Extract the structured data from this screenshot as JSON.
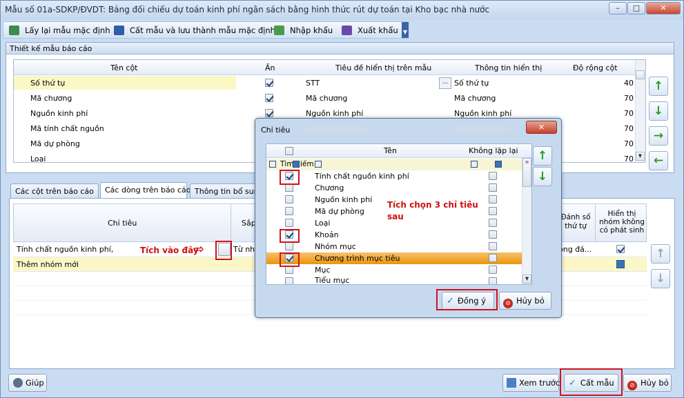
{
  "window": {
    "title": "Mẫu số 01a-SDKP/ĐVDT: Bảng đối chiếu dự toán kinh phí ngân sách bằng hình thức rút dự toán tại Kho bạc nhà nước",
    "btn_min": "–",
    "btn_max": "□",
    "btn_close": "✕"
  },
  "toolbar": {
    "reset": "Lấy lại mẫu mặc định",
    "save": "Cất mẫu và lưu thành mẫu mặc định",
    "import": "Nhập khẩu",
    "export": "Xuất khẩu"
  },
  "design": {
    "header": "Thiết kế mẫu báo cáo",
    "columns": {
      "name": "Tên cột",
      "hide": "Ẩn",
      "caption": "Tiêu đề hiển thị trên mẫu",
      "info": "Thông tin hiển thị",
      "width": "Độ rộng cột"
    },
    "rows": [
      {
        "name": "Số thứ tự",
        "hide": true,
        "caption": "STT",
        "info": "Số thứ tự",
        "width": "40"
      },
      {
        "name": "Mã chương",
        "hide": true,
        "caption": "Mã chương",
        "info": "Mã chương",
        "width": "70"
      },
      {
        "name": "Nguồn kinh phí",
        "hide": true,
        "caption": "Nguồn kinh phí",
        "info": "Nguồn kinh phí",
        "width": "70"
      },
      {
        "name": "Mã tính chất nguồn",
        "hide": false,
        "caption": "",
        "info": "",
        "width": "70"
      },
      {
        "name": "Mã dự phòng",
        "hide": false,
        "caption": "",
        "info": "",
        "width": "70"
      },
      {
        "name": "Loại",
        "hide": false,
        "caption": "",
        "info": "",
        "width": "70"
      }
    ],
    "ellipsis": "..."
  },
  "tabs": [
    "Các cột trên báo cáo",
    "Các dòng trên báo cáo",
    "Thông tin bổ sung"
  ],
  "lower": {
    "col_chitieu": "Chỉ tiêu",
    "col_sap": "Sắp",
    "col_danhso": "Đánh số thứ tự",
    "col_hienthi": "Hiển thị nhóm không có phát sinh",
    "row1_chitieu": "Tính chất nguồn kinh phí,",
    "row1_sap": "Từ nhó",
    "row1_danhso": "ông đá...",
    "row2_chitieu": "Thêm nhóm mới"
  },
  "annotations": {
    "tich_vao_day": "Tích vào đây",
    "tich_chon": "Tích chọn 3 chỉ tiêu sau"
  },
  "dialog": {
    "title": "Chỉ tiêu",
    "close": "✕",
    "col_ten": "Tên",
    "col_khong_lap": "Không lặp lại",
    "filter_label": "Tìm kiếm",
    "items": [
      {
        "name": "Tính chất nguồn kinh phí",
        "checked": true
      },
      {
        "name": "Chương",
        "checked": false
      },
      {
        "name": "Nguồn kinh phí",
        "checked": false
      },
      {
        "name": "Mã dự phòng",
        "checked": false
      },
      {
        "name": "Loại",
        "checked": false
      },
      {
        "name": "Khoản",
        "checked": true
      },
      {
        "name": "Nhóm mục",
        "checked": false
      },
      {
        "name": "Chương trình mục tiêu",
        "checked": true
      },
      {
        "name": "Mục",
        "checked": false
      },
      {
        "name": "Tiểu mục",
        "checked": false
      }
    ],
    "ok": "Đồng ý",
    "cancel": "Hủy bỏ"
  },
  "bottom": {
    "help": "Giúp",
    "preview": "Xem trước",
    "save": "Cất mẫu",
    "cancel": "Hủy bỏ"
  },
  "colors": {
    "accent_red": "#d0111b",
    "selection": "#e8960f",
    "green_arrow": "#2a9a2a"
  }
}
